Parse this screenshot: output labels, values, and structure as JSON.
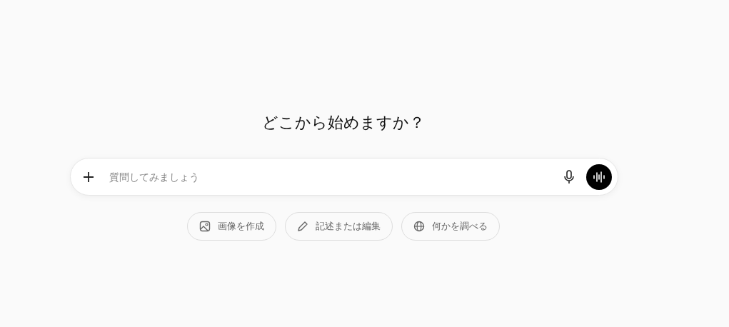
{
  "heading": "どこから始めますか？",
  "composer": {
    "placeholder": "質問してみましょう"
  },
  "chips": [
    {
      "kind": "image",
      "label": "画像を作成"
    },
    {
      "kind": "edit",
      "label": "記述または編集"
    },
    {
      "kind": "globe",
      "label": "何かを調べる"
    }
  ]
}
